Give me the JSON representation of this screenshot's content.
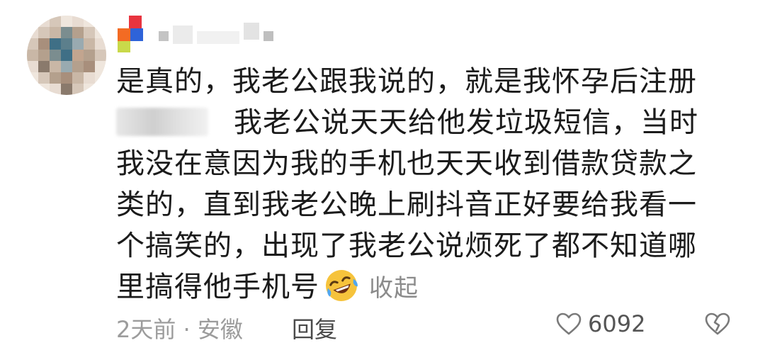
{
  "comment": {
    "lines": [
      "是真的，我老公跟我说的，就是我怀孕后注册",
      "我老公说天天给他发垃圾短信，当时",
      "我没在意因为我的手机也天天收到借款贷款之",
      "类的，直到我老公晚上刷抖音正好要给我看一",
      "个搞笑的，出现了我老公说烦死了都不知道哪",
      "里搞得他手机号"
    ],
    "collapse_label": "收起"
  },
  "footer": {
    "meta": "2天前 · 安徽",
    "reply_label": "回复",
    "like_count": "6092"
  },
  "icons": {
    "emoji": "rolling-laughing-emoji",
    "like": "heart-icon",
    "dislike": "broken-heart-icon"
  },
  "colors": {
    "text": "#1b1b1b",
    "muted": "#9c9c9c",
    "link": "#8b8b8b",
    "emoji_face": "#f6c33c"
  }
}
